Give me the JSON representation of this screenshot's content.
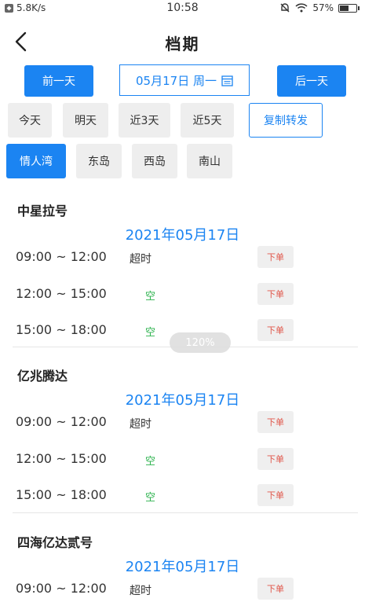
{
  "status_bar": {
    "net_speed": "5.8K/s",
    "time": "10:58",
    "battery": "57%",
    "battery_level": 0.57
  },
  "nav": {
    "title": "档期"
  },
  "date_nav": {
    "prev_label": "前一天",
    "next_label": "后一天",
    "date_label": "05月17日 周一"
  },
  "quick_days": [
    "今天",
    "明天",
    "近3天",
    "近5天"
  ],
  "copy_label": "复制转发",
  "locations": [
    {
      "label": "情人湾",
      "active": true
    },
    {
      "label": "东岛",
      "active": false
    },
    {
      "label": "西岛",
      "active": false
    },
    {
      "label": "南山",
      "active": false
    }
  ],
  "zoom": "120%",
  "sections": [
    {
      "name": "中星拉号",
      "date": "2021年05月17日",
      "slots": [
        {
          "time": "09:00 ~ 12:00",
          "status": "超时",
          "free": false,
          "action": "下单"
        },
        {
          "time": "12:00 ~ 15:00",
          "status": "空",
          "free": true,
          "action": "下单"
        },
        {
          "time": "15:00 ~ 18:00",
          "status": "空",
          "free": true,
          "action": "下单"
        }
      ]
    },
    {
      "name": "亿兆腾达",
      "date": "2021年05月17日",
      "slots": [
        {
          "time": "09:00 ~ 12:00",
          "status": "超时",
          "free": false,
          "action": "下单"
        },
        {
          "time": "12:00 ~ 15:00",
          "status": "空",
          "free": true,
          "action": "下单"
        },
        {
          "time": "15:00 ~ 18:00",
          "status": "空",
          "free": true,
          "action": "下单"
        }
      ]
    },
    {
      "name": "四海亿达贰号",
      "date": "2021年05月17日",
      "slots": [
        {
          "time": "09:00 ~ 12:00",
          "status": "超时",
          "free": false,
          "action": "下单"
        }
      ]
    }
  ]
}
